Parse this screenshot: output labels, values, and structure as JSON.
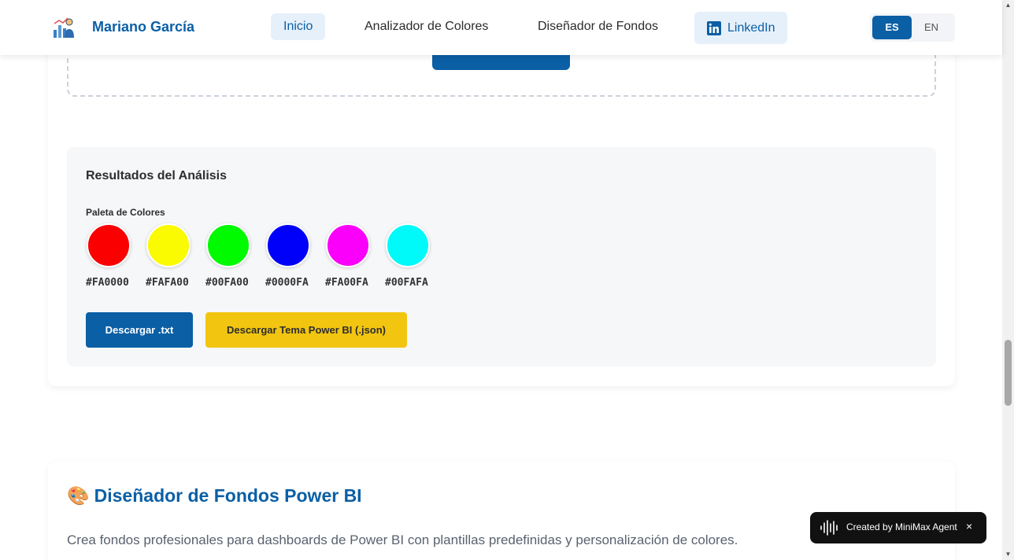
{
  "header": {
    "brand": "Mariano García",
    "logo_icon": "analytics-person-icon",
    "nav": [
      {
        "label": "Inicio",
        "active": true
      },
      {
        "label": "Analizador de Colores",
        "active": false
      },
      {
        "label": "Diseñador de Fondos",
        "active": false
      }
    ],
    "linkedin": {
      "label": "LinkedIn",
      "icon": "linkedin-icon"
    },
    "languages": [
      {
        "label": "ES",
        "active": true
      },
      {
        "label": "EN",
        "active": false
      }
    ]
  },
  "results": {
    "title": "Resultados del Análisis",
    "palette_label": "Paleta de Colores",
    "colors": [
      "#FA0000",
      "#FAFA00",
      "#00FA00",
      "#0000FA",
      "#FA00FA",
      "#00FAFA"
    ],
    "download_txt": "Descargar .txt",
    "download_json": "Descargar Tema Power BI (.json)"
  },
  "designer": {
    "emoji": "🎨",
    "title": "Diseñador de Fondos Power BI",
    "description": "Crea fondos profesionales para dashboards de Power BI con plantillas predefinidas y personalización de colores."
  },
  "badge": {
    "text": "Created by MiniMax Agent",
    "icon": "waveform-icon",
    "close": "×"
  },
  "colors": {
    "primary": "#0b5fa5",
    "accent": "#f2c511",
    "nav_active_bg": "#e6f0fa"
  }
}
